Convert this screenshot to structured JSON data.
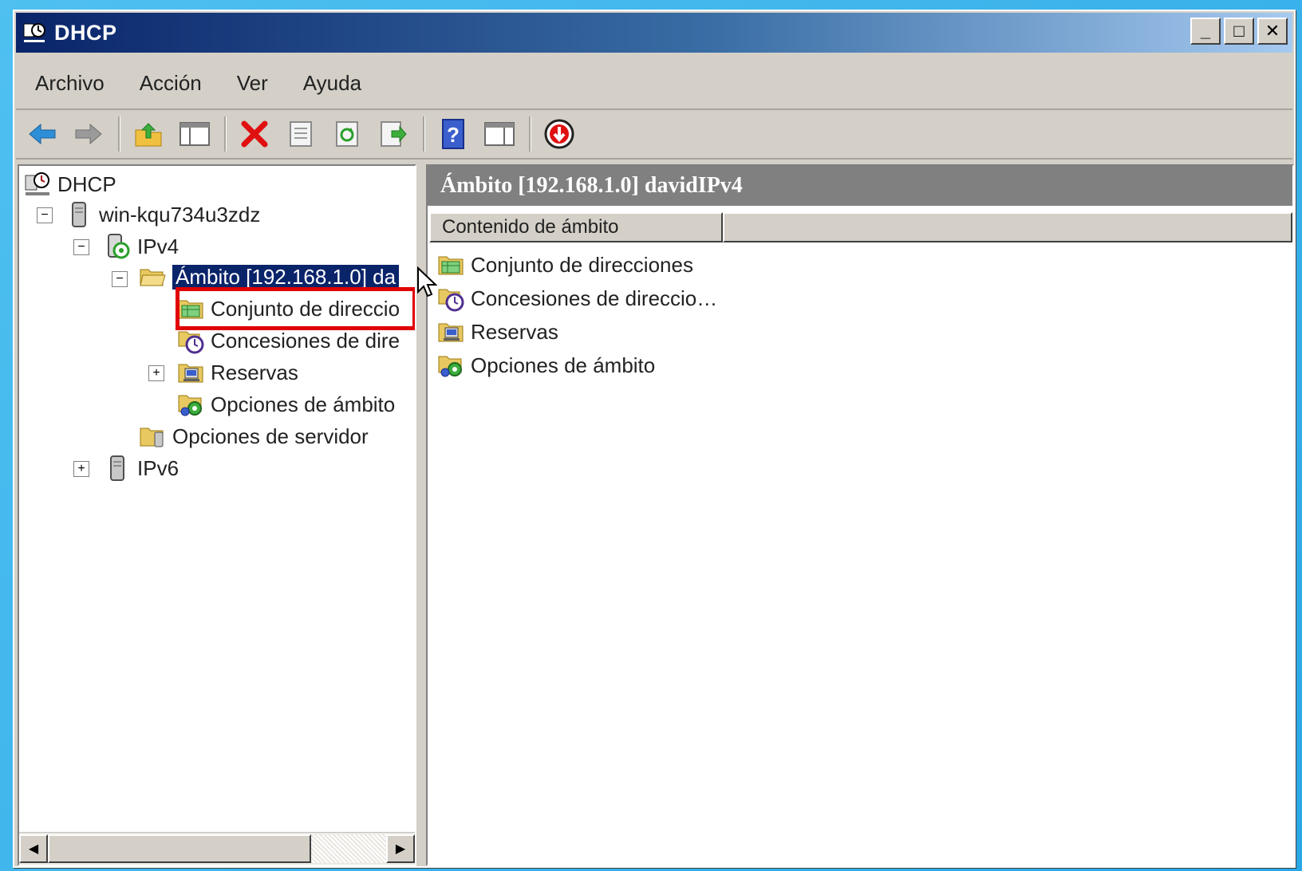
{
  "window": {
    "title": "DHCP"
  },
  "menu": [
    "Archivo",
    "Acción",
    "Ver",
    "Ayuda"
  ],
  "toolbar": {
    "buttons": [
      "back-icon",
      "forward-icon",
      "up-folder-icon",
      "show-hide-tree-icon",
      "delete-icon",
      "properties-icon",
      "refresh-icon",
      "export-list-icon",
      "help-icon",
      "show-hide-action-pane-icon",
      "stop-server-icon"
    ]
  },
  "tree": {
    "root": "DHCP",
    "server": "win-kqu734u3zdz",
    "ipv4": "IPv4",
    "scope": "Ámbito [192.168.1.0] da",
    "pool": "Conjunto de direccio",
    "leases": "Concesiones de dire",
    "reservations": "Reservas",
    "scope_options": "Opciones de ámbito",
    "server_options": "Opciones de servidor",
    "ipv6": "IPv6"
  },
  "right": {
    "header": "Ámbito [192.168.1.0] davidIPv4",
    "column": "Contenido de ámbito",
    "items": [
      "Conjunto de direcciones",
      "Concesiones de direccio…",
      "Reservas",
      "Opciones de ámbito"
    ]
  },
  "colors": {
    "selection": "#0a246a",
    "highlight": "#e00000",
    "header_gray": "#808080"
  }
}
